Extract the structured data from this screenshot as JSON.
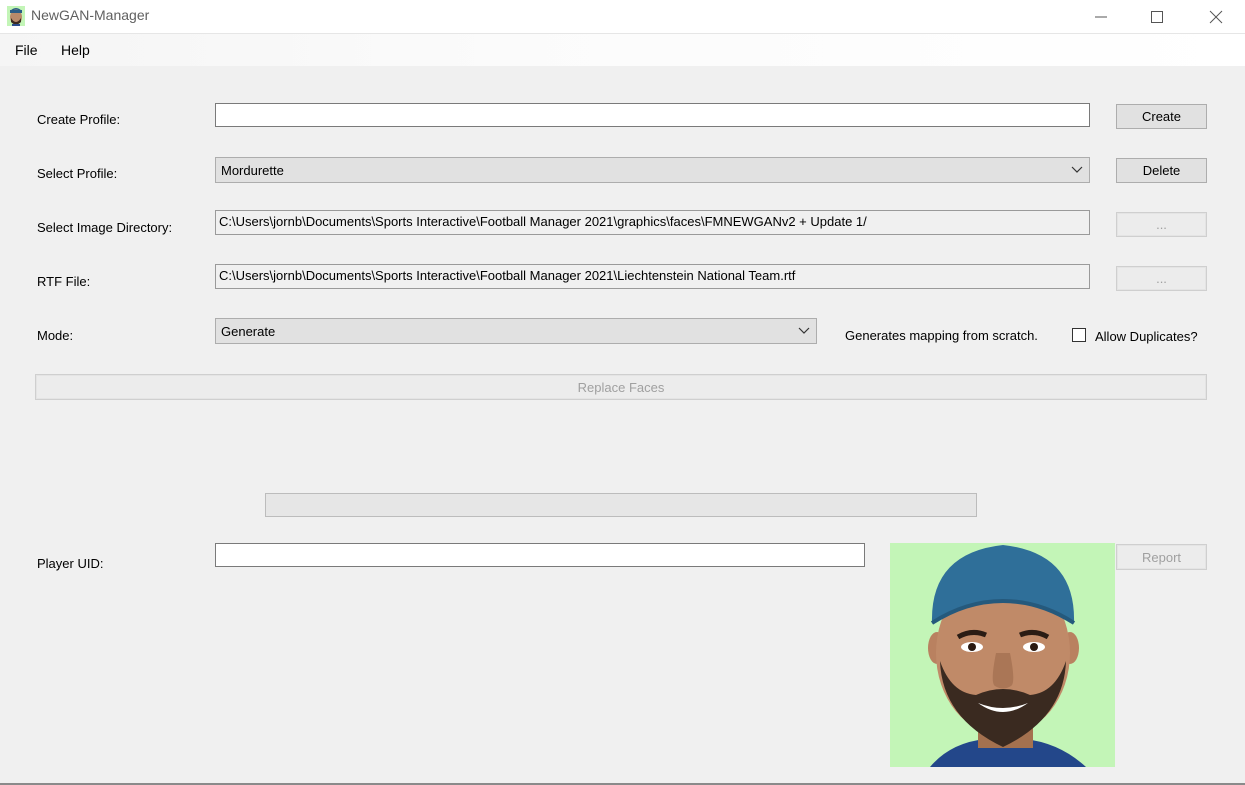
{
  "window": {
    "title": "NewGAN-Manager",
    "icon": "face-app-icon",
    "controls": [
      "minimize-icon",
      "maximize-icon",
      "close-icon"
    ]
  },
  "menu": {
    "file": "File",
    "help": "Help"
  },
  "form": {
    "create_profile_label": "Create Profile:",
    "create_profile_value": "",
    "create_button": "Create",
    "select_profile_label": "Select Profile:",
    "select_profile_value": "Mordurette",
    "delete_button": "Delete",
    "image_dir_label": "Select Image Directory:",
    "image_dir_value": "C:\\Users\\jornb\\Documents\\Sports Interactive\\Football Manager 2021\\graphics\\faces\\FMNEWGANv2 + Update 1/",
    "image_dir_browse": "...",
    "rtf_label": "RTF File:",
    "rtf_value": "C:\\Users\\jornb\\Documents\\Sports Interactive\\Football Manager 2021\\Liechtenstein National Team.rtf",
    "rtf_browse": "...",
    "mode_label": "Mode:",
    "mode_value": "Generate",
    "mode_description": "Generates mapping from scratch.",
    "allow_duplicates_label": "Allow Duplicates?",
    "allow_duplicates_checked": false,
    "replace_button": "Replace Faces",
    "progress": 0,
    "player_uid_label": "Player UID:",
    "player_uid_value": "",
    "report_button": "Report"
  },
  "colors": {
    "window_bg": "#f0f0f0",
    "face_bg": "#c3f5b7",
    "button_bg": "#e1e1e1",
    "disabled_text": "#a0a0a0"
  }
}
